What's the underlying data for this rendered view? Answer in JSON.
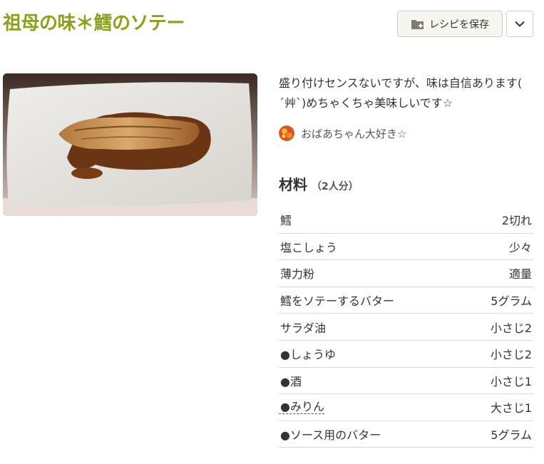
{
  "recipe": {
    "title": "祖母の味＊鱈のソテー",
    "description": "盛り付けセンスないですが、味は自信あります( ´艸`)めちゃくちゃ美味しいです☆",
    "author": "おばあちゃん大好き☆",
    "ingredients_title": "材料",
    "servings": "（2人分）",
    "ingredients": [
      {
        "name": "鱈",
        "qty": "2切れ"
      },
      {
        "name": "塩こしょう",
        "qty": "少々"
      },
      {
        "name": "薄力粉",
        "qty": "適量"
      },
      {
        "name": "鱈をソテーするバター",
        "qty": "5グラム"
      },
      {
        "name": "サラダ油",
        "qty": "小さじ2"
      },
      {
        "name": "●しょうゆ",
        "qty": "小さじ2"
      },
      {
        "name": "●酒",
        "qty": "小さじ1"
      },
      {
        "name": "●みりん",
        "qty": "大さじ1"
      },
      {
        "name": "●ソース用のバター",
        "qty": "5グラム"
      }
    ]
  },
  "toolbar": {
    "save_label": "レシピを保存",
    "save_icon": "folder-add-icon",
    "menu_icon": "chevron-down-icon"
  },
  "colors": {
    "title": "#8aa21b",
    "text": "#333333"
  }
}
